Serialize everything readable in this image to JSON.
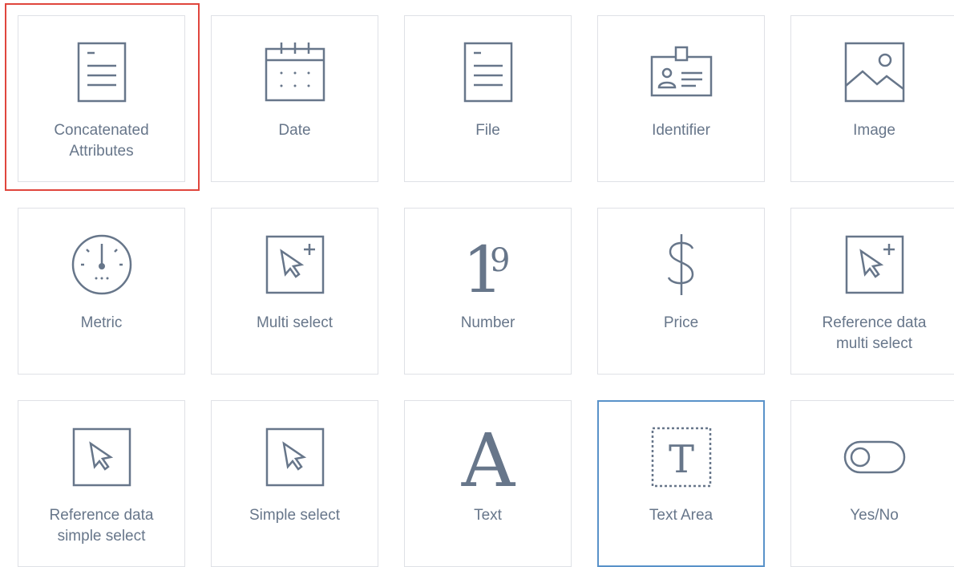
{
  "colors": {
    "icon": "#67768a",
    "tile_border": "#dfe1e6",
    "selected_outline": "#e0463d",
    "hover_border": "#5992c9"
  },
  "tiles": [
    {
      "label_line1": "Concatenated",
      "label_line2": "Attributes",
      "icon": "document-lines-icon",
      "selected": true
    },
    {
      "label_line1": "Date",
      "label_line2": "",
      "icon": "calendar-icon"
    },
    {
      "label_line1": "File",
      "label_line2": "",
      "icon": "file-icon"
    },
    {
      "label_line1": "Identifier",
      "label_line2": "",
      "icon": "id-badge-icon"
    },
    {
      "label_line1": "Image",
      "label_line2": "",
      "icon": "image-icon"
    },
    {
      "label_line1": "Metric",
      "label_line2": "",
      "icon": "gauge-icon"
    },
    {
      "label_line1": "Multi select",
      "label_line2": "",
      "icon": "cursor-plus-icon"
    },
    {
      "label_line1": "Number",
      "label_line2": "",
      "icon": "number-icon",
      "glyph_text": "19"
    },
    {
      "label_line1": "Price",
      "label_line2": "",
      "icon": "dollar-icon",
      "glyph_text": "$"
    },
    {
      "label_line1": "Reference data",
      "label_line2": "multi select",
      "icon": "cursor-plus-icon"
    },
    {
      "label_line1": "Reference data",
      "label_line2": "simple select",
      "icon": "cursor-icon"
    },
    {
      "label_line1": "Simple select",
      "label_line2": "",
      "icon": "cursor-icon"
    },
    {
      "label_line1": "Text",
      "label_line2": "",
      "icon": "letter-a-icon",
      "glyph_text": "A"
    },
    {
      "label_line1": "Text Area",
      "label_line2": "",
      "icon": "text-area-icon",
      "glyph_text": "T",
      "hovered": true
    },
    {
      "label_line1": "Yes/No",
      "label_line2": "",
      "icon": "toggle-icon"
    }
  ]
}
